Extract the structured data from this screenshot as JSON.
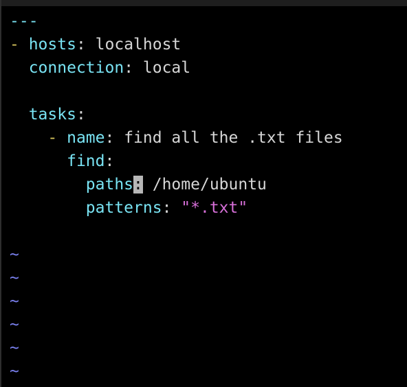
{
  "editor": {
    "lines": [
      {
        "doc_start": "---"
      },
      {
        "dash": "- ",
        "key": "hosts",
        "colon": ":",
        "value": " localhost"
      },
      {
        "indent": "  ",
        "key": "connection",
        "colon": ":",
        "value": " local"
      },
      {},
      {
        "indent": "  ",
        "key": "tasks",
        "colon": ":"
      },
      {
        "indent": "    ",
        "dash": "- ",
        "key": "name",
        "colon": ":",
        "value": " find all the .txt files"
      },
      {
        "indent": "      ",
        "key": "find",
        "colon": ":"
      },
      {
        "indent": "        ",
        "key": "paths",
        "cursor_char": ":",
        "value": " /home/ubuntu"
      },
      {
        "indent": "        ",
        "key": "patterns",
        "colon": ":",
        "pre": " ",
        "string": "\"*.txt\""
      }
    ],
    "empty_line_marker": "~"
  },
  "colors": {
    "background": "#000000",
    "key": "#79e3f3",
    "dash": "#d3c15a",
    "string": "#d66fd8",
    "tilde": "#7a81f0",
    "cursor": "#b7b7b7"
  }
}
